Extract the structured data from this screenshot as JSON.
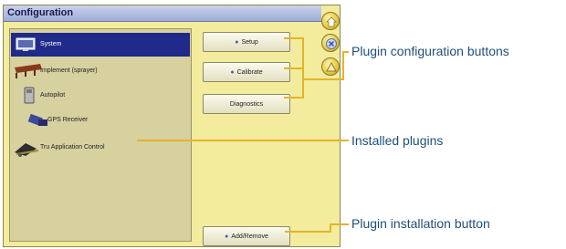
{
  "window": {
    "title": "Configuration"
  },
  "plugins": [
    {
      "label": "System",
      "icon": "monitor-icon",
      "selected": true
    },
    {
      "label": "Implement (sprayer)",
      "icon": "sprayer-implement-icon",
      "selected": false
    },
    {
      "label": "Autopilot",
      "icon": "autopilot-icon",
      "selected": false
    },
    {
      "label": "GPS Receiver",
      "icon": "gps-receiver-icon",
      "selected": false
    },
    {
      "label": "Tru Application Control",
      "icon": "application-control-icon",
      "selected": false
    }
  ],
  "buttons": {
    "setup": "Setup",
    "calibrate": "Calibrate",
    "diagnostics": "Diagnostics",
    "add_remove": "Add/Remove"
  },
  "side_buttons": [
    "home-icon",
    "close-icon",
    "help-icon"
  ],
  "callouts": {
    "plugin_config": "Plugin configuration buttons",
    "installed": "Installed plugins",
    "install_button": "Plugin installation button"
  },
  "colors": {
    "accent_line": "#e3b42c",
    "selection": "#1f2a8a",
    "panel_bg": "#f3ec9c",
    "callout_text": "#1d4f7a"
  }
}
